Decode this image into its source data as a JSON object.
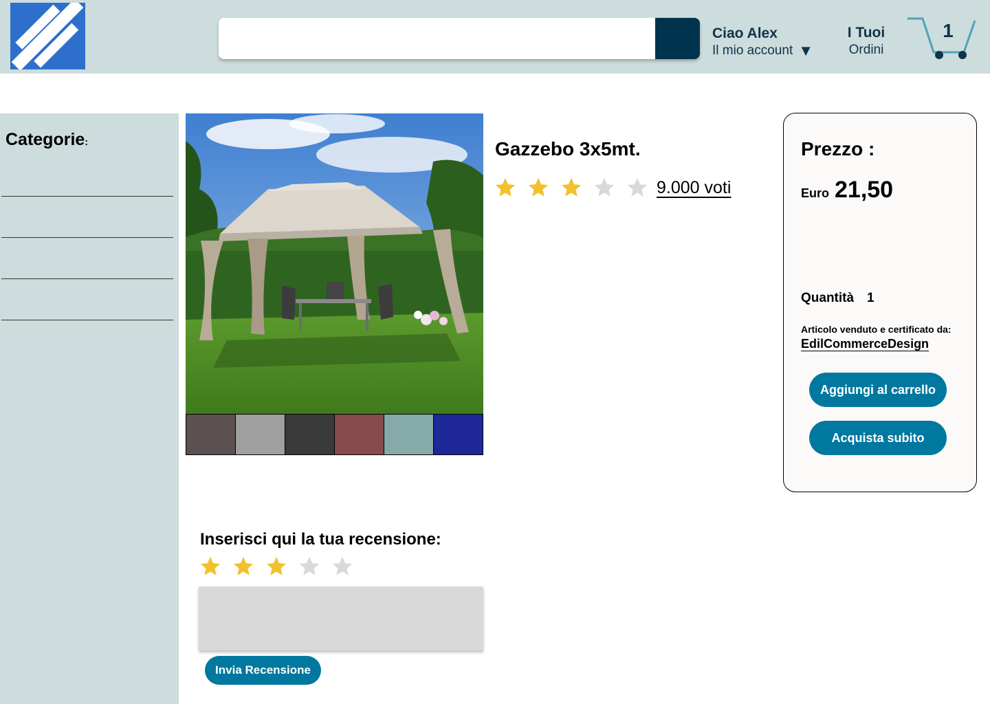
{
  "header": {
    "search": {
      "placeholder": "",
      "value": ""
    },
    "account": {
      "greeting": "Ciao Alex",
      "label": "Il mio account",
      "caret": "▼"
    },
    "orders": {
      "line1": "I Tuoi",
      "line2": "Ordini"
    },
    "cart": {
      "count": "1"
    }
  },
  "sidebar": {
    "title": "Categorie",
    "title_suffix": ":"
  },
  "product": {
    "title": "Gazzebo 3x5mt.",
    "rating": 3,
    "rating_max": 5,
    "votes": "9.000 voti",
    "swatches": [
      "#5c5050",
      "#9f9f9f",
      "#3a3a3a",
      "#864b4a",
      "#86aaa8",
      "#1f2898"
    ]
  },
  "pricebox": {
    "label": "Prezzo :",
    "currency": "Euro",
    "value": "21,50",
    "qty_label": "Quantità",
    "qty_value": "1",
    "sold_by": "Articolo venduto e certificato da:",
    "seller": "EdilCommerceDesign",
    "add_to_cart": "Aggiungi al carrello",
    "buy_now": "Acquista subito"
  },
  "review": {
    "title": "Inserisci qui la tua recensione:",
    "rating": 3,
    "rating_max": 5,
    "text": "",
    "submit": "Invia Recensione"
  },
  "colors": {
    "header_bg": "#cddcdc",
    "accent": "#00789f",
    "search_button": "#00334d",
    "star_on": "#f2c12e",
    "star_off": "#d9d9d9"
  }
}
